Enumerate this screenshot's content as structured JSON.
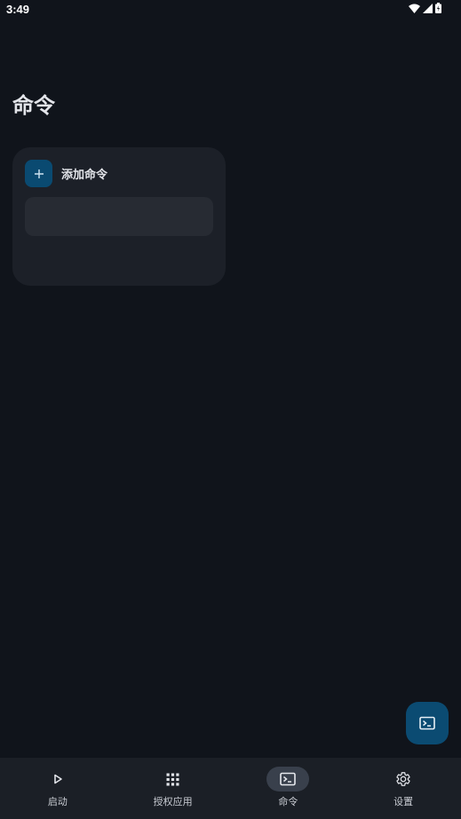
{
  "status_bar": {
    "time": "3:49",
    "icons": [
      "wifi-icon",
      "signal-icon",
      "battery-icon"
    ]
  },
  "page": {
    "title": "命令"
  },
  "card": {
    "add_label": "添加命令",
    "input_value": ""
  },
  "fab": {
    "icon": "terminal-icon"
  },
  "bottom_nav": {
    "items": [
      {
        "label": "启动",
        "icon": "play-icon",
        "active": false
      },
      {
        "label": "授权应用",
        "icon": "apps-grid-icon",
        "active": false
      },
      {
        "label": "命令",
        "icon": "terminal-icon",
        "active": true
      },
      {
        "label": "设置",
        "icon": "gear-icon",
        "active": false
      }
    ]
  },
  "colors": {
    "background": "#10141b",
    "card": "#1c2028",
    "input": "#272b33",
    "accent": "#0a4a71",
    "nav_bar": "#1b1f26",
    "nav_active_pill": "#39404c"
  }
}
